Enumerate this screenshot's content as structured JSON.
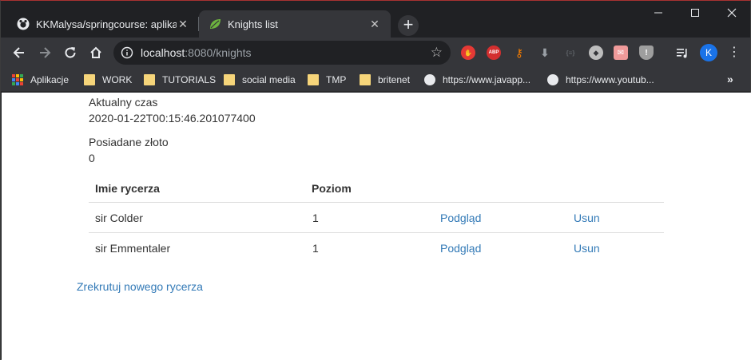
{
  "browser": {
    "tabs": [
      {
        "title": "KKMalysa/springcourse: aplikacja",
        "favicon": "github-icon",
        "active": false
      },
      {
        "title": "Knights list",
        "favicon": "spring-leaf-icon",
        "active": true
      }
    ],
    "new_tab_label": "+",
    "window_controls": {
      "minimize": "—",
      "maximize": "☐",
      "close": "✕"
    },
    "address": {
      "host": "localhost",
      "path": ":8080/knights"
    },
    "avatar_initial": "K",
    "extensions": [
      {
        "name": "stop-extension-icon",
        "color": "#e53935",
        "text": "✋"
      },
      {
        "name": "adblock-plus-icon",
        "color": "#d32f2f",
        "text": "ABP"
      },
      {
        "name": "key-extension-icon",
        "color": "#f57c00",
        "text": "🔑"
      },
      {
        "name": "download-extension-icon",
        "color": "#9aa0a6",
        "text": "⬇"
      },
      {
        "name": "json-extension-icon",
        "color": "#5f6368",
        "text": "{≡}"
      },
      {
        "name": "compass-extension-icon",
        "color": "#bdbdbd",
        "text": "◆"
      },
      {
        "name": "mail-extension-icon",
        "color": "#e57373",
        "text": "✉"
      },
      {
        "name": "shield-extension-icon",
        "color": "#9e9e9e",
        "text": "!"
      }
    ]
  },
  "bookmarks": {
    "items": [
      {
        "label": "Aplikacje",
        "icon": "apps-grid-icon"
      },
      {
        "label": "WORK",
        "icon": "folder-icon"
      },
      {
        "label": "TUTORIALS",
        "icon": "folder-icon"
      },
      {
        "label": "social media",
        "icon": "folder-icon"
      },
      {
        "label": "TMP",
        "icon": "folder-icon"
      },
      {
        "label": "britenet",
        "icon": "folder-icon"
      },
      {
        "label": "https://www.javapp...",
        "icon": "globe-icon"
      },
      {
        "label": "https://www.youtub...",
        "icon": "globe-icon"
      }
    ],
    "more": "»"
  },
  "page": {
    "time_label": "Aktualny czas",
    "time_value": "2020-01-22T00:15:46.201077400",
    "gold_label": "Posiadane złoto",
    "gold_value": "0",
    "table": {
      "headers": [
        "Imie rycerza",
        "Poziom"
      ],
      "rows": [
        {
          "name": "sir Colder",
          "level": "1",
          "view": "Podgląd",
          "delete": "Usun"
        },
        {
          "name": "sir Emmentaler",
          "level": "1",
          "view": "Podgląd",
          "delete": "Usun"
        }
      ]
    },
    "recruit_link": "Zrekrutuj nowego rycerza"
  }
}
